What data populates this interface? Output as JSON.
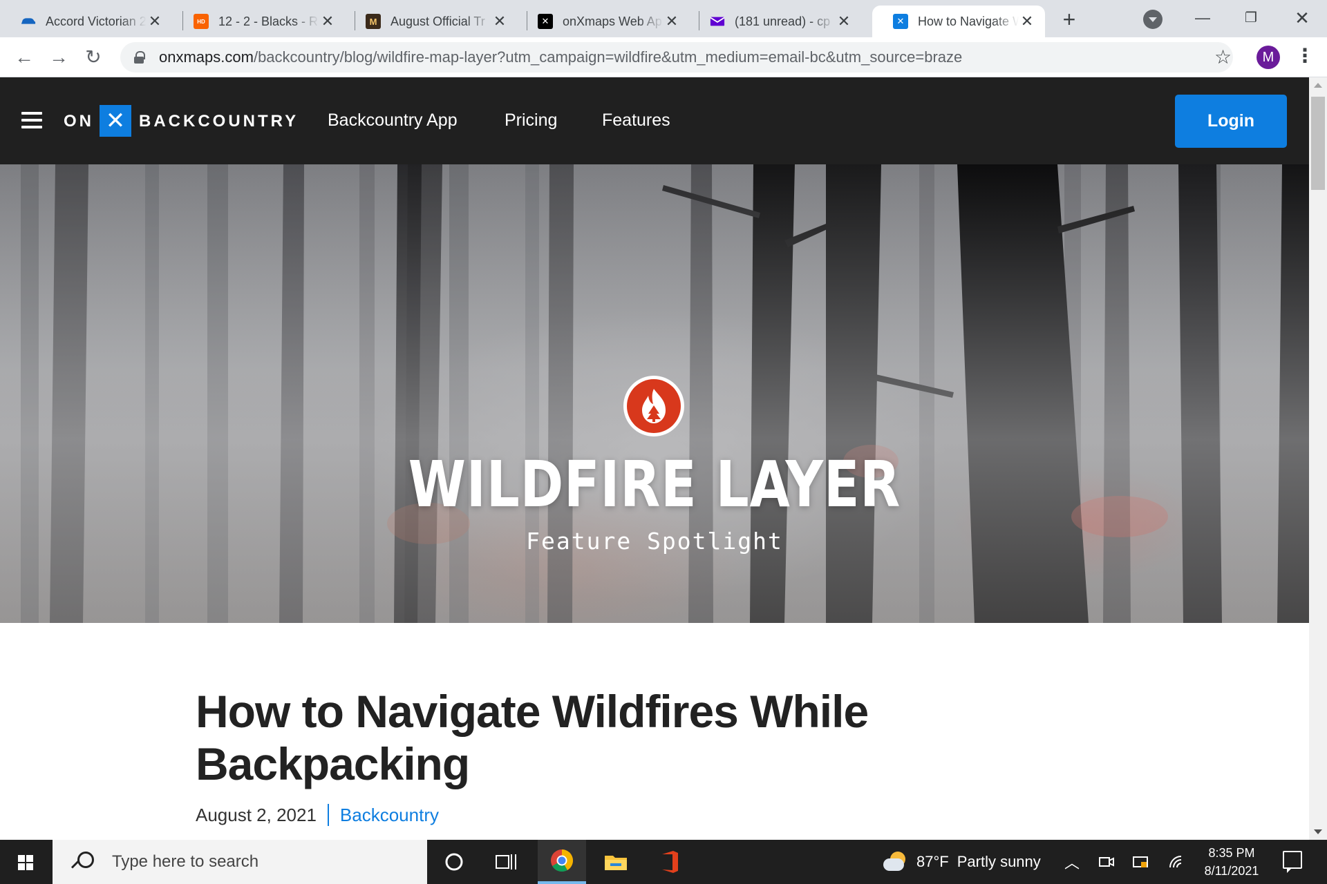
{
  "browser": {
    "tabs": [
      {
        "label": "Accord Victorian 2",
        "favicon_color": "#1565c0"
      },
      {
        "label": "12 - 2 - Blacks - R",
        "favicon_color": "#f96302"
      },
      {
        "label": "August Official Tr",
        "favicon_color": "#3b2a1a"
      },
      {
        "label": "onXmaps Web Ap",
        "favicon_color": "#000000"
      },
      {
        "label": "(181 unread) - cp",
        "favicon_color": "#6001d2"
      },
      {
        "label": "How to Navigate W",
        "favicon_color": "#0e7ee0"
      }
    ],
    "active_tab": 5,
    "url_host": "onxmaps.com",
    "url_path": "/backcountry/blog/wildfire-map-layer?utm_campaign=wildfire&utm_medium=email-bc&utm_source=braze",
    "profile_initial": "M"
  },
  "site": {
    "logo_on": "ON",
    "logo_x": "✕",
    "logo_brand": "BACKCOUNTRY",
    "nav": [
      "Backcountry App",
      "Pricing",
      "Features"
    ],
    "login_label": "Login",
    "accent": "#0e7ee0"
  },
  "hero": {
    "title": "WILDFIRE LAYER",
    "subtitle": "Feature Spotlight",
    "badge_color": "#d8381c"
  },
  "article": {
    "title": "How to Navigate Wildfires While Backpacking",
    "date": "August 2, 2021",
    "category": "Backcountry"
  },
  "taskbar": {
    "search_placeholder": "Type here to search",
    "weather_temp": "87°F",
    "weather_desc": "Partly sunny",
    "time": "8:35 PM",
    "date": "8/11/2021"
  }
}
